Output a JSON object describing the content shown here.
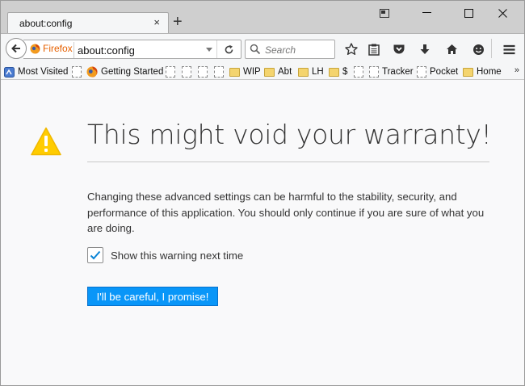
{
  "tab": {
    "title": "about:config",
    "close_glyph": "×",
    "new_tab_glyph": "+"
  },
  "urlbar": {
    "identity_label": "Firefox",
    "url": "about:config"
  },
  "searchbar": {
    "placeholder": "Search"
  },
  "bookmarks": {
    "most_visited": "Most Visited",
    "getting_started": "Getting Started",
    "wip": "WIP",
    "abt": "Abt",
    "lh": "LH",
    "dollar": "$",
    "tracker": "Tracker",
    "pocket": "Pocket",
    "home": "Home",
    "overflow_glyph": "»"
  },
  "warning": {
    "title": "This might void your warranty!",
    "description": "Changing these advanced settings can be harmful to the stability, security, and performance of this application. You should only continue if you are sure of what you are doing.",
    "checkbox_label": "Show this warning next time",
    "checkbox_checked": true,
    "button_label": "I'll be careful, I promise!"
  },
  "colors": {
    "accent_button": "#0996f8",
    "warning_icon": "#ffcc00",
    "firefox_identity": "#e66000"
  }
}
